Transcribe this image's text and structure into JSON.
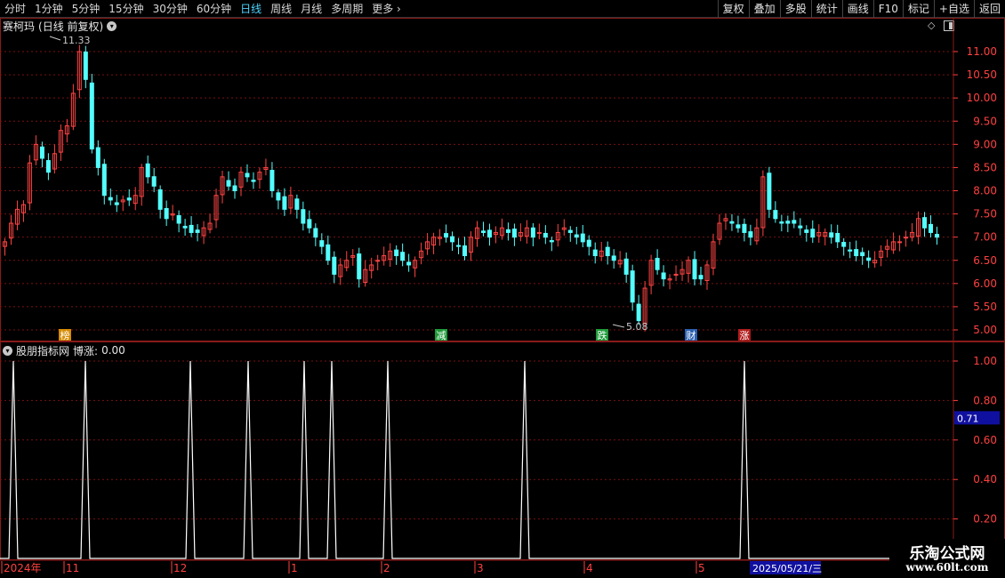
{
  "toolbar": {
    "periods": [
      "分时",
      "1分钟",
      "5分钟",
      "15分钟",
      "30分钟",
      "60分钟",
      "日线",
      "周线",
      "月线",
      "多周期",
      "更多"
    ],
    "active_period": "日线",
    "more_arrow": "›",
    "tools": [
      "复权",
      "叠加",
      "多股",
      "统计",
      "画线",
      "F10",
      "标记",
      "+自选",
      "返回"
    ]
  },
  "main_panel": {
    "stock_name": "赛柯玛",
    "mode": "(日线 前复权)",
    "high_label": "11.33",
    "low_label": "5.08",
    "price_ticks": [
      "11.00",
      "10.50",
      "10.00",
      "9.50",
      "9.00",
      "8.50",
      "8.00",
      "7.50",
      "7.00",
      "6.50",
      "6.00",
      "5.50",
      "5.00"
    ],
    "event_markers": [
      {
        "label": "榜",
        "color": "#d58a00"
      },
      {
        "label": "减",
        "color": "#1f9a3a"
      },
      {
        "label": "跌",
        "color": "#1f9a3a"
      },
      {
        "label": "财",
        "color": "#2b5fb0"
      },
      {
        "label": "涨",
        "color": "#b01c1c"
      }
    ]
  },
  "indicator_panel": {
    "name": "股朋指标网",
    "series_label": "博涨:",
    "series_value": "0.00",
    "ticks": [
      "1.00",
      "0.80",
      "0.60",
      "0.40",
      "0.20"
    ],
    "current_value": "0.71",
    "current_value_color": "#1010a0"
  },
  "date_axis": {
    "labels": [
      "2024年",
      "11",
      "12",
      "1",
      "2",
      "3",
      "4",
      "5"
    ],
    "cursor_date": "2025/05/21/三"
  },
  "watermark": {
    "title": "乐淘公式网",
    "url": "www.60lt.com"
  },
  "colors": {
    "up": "#ff4444",
    "down": "#54ffff",
    "grid": "#7a1010",
    "axis_text": "#ff4040",
    "indicator_line": "#ffffff",
    "active_period": "#4fd4ff"
  },
  "chart_data": {
    "type": "candlestick",
    "price_range": [
      4.95,
      11.7
    ],
    "spikes_indicator": {
      "range": [
        0,
        1.1
      ],
      "baseline": 0,
      "spike_value": 1.0
    }
  }
}
